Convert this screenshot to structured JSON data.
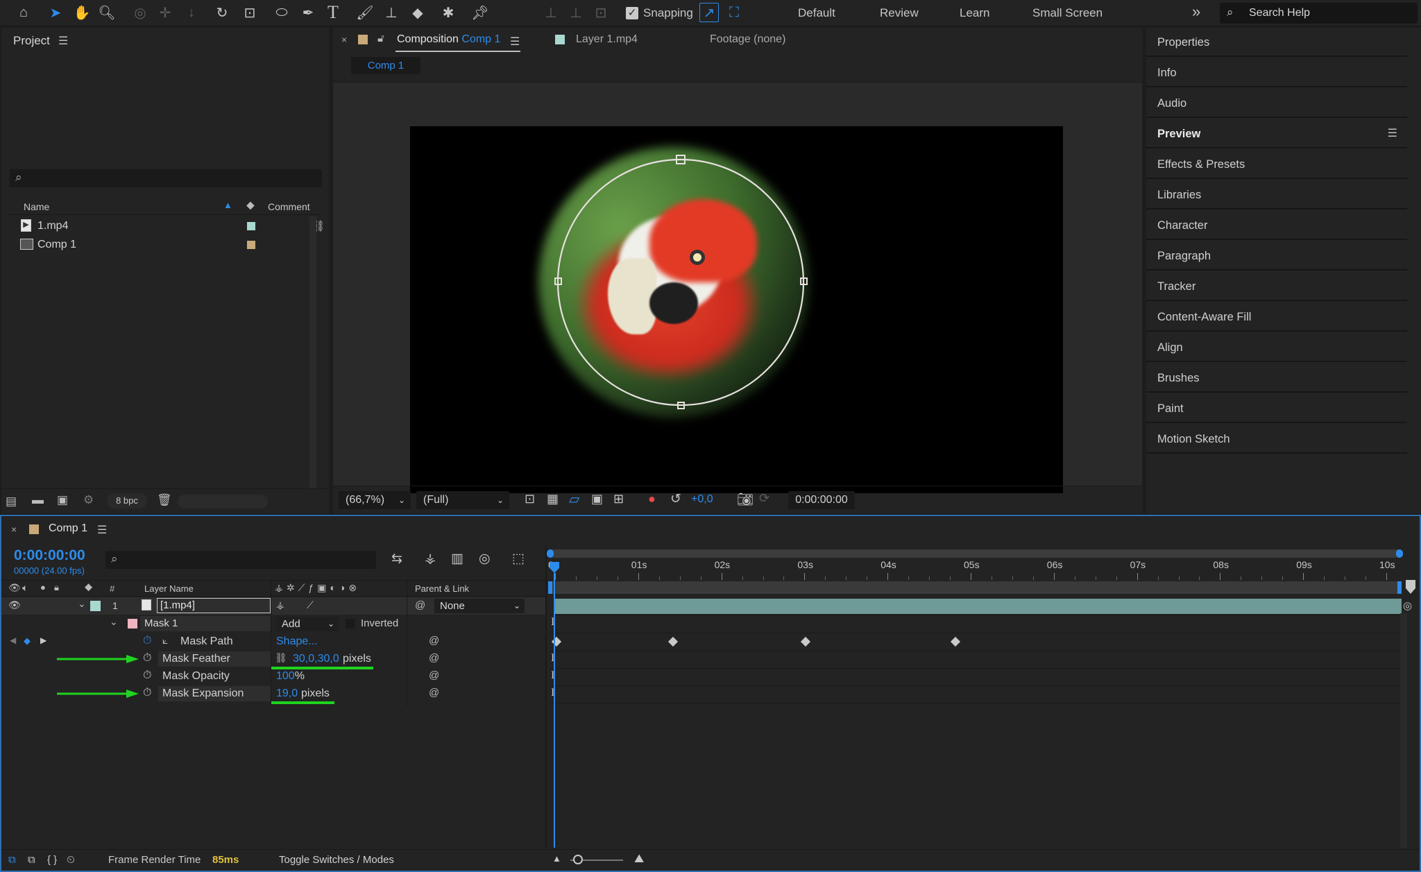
{
  "toolbar": {
    "snapping_label": "Snapping",
    "workspaces": [
      "Default",
      "Review",
      "Learn",
      "Small Screen"
    ],
    "more_label": "»",
    "search_placeholder": "Search Help"
  },
  "project": {
    "title": "Project",
    "col_name": "Name",
    "col_comment": "Comment",
    "items": [
      {
        "name": "1.mp4",
        "label_color": "#a8d8d0"
      },
      {
        "name": "Comp 1",
        "label_color": "#c9a97a"
      }
    ],
    "bpc": "8 bpc"
  },
  "viewer": {
    "tab_composition": "Composition",
    "tab_composition_name": "Comp 1",
    "tab_layer": "Layer 1.mp4",
    "tab_footage": "Footage (none)",
    "subtab": "Comp 1",
    "zoom": "(66,7%)",
    "resolution": "(Full)",
    "exposure": "+0,0",
    "timecode": "0:00:00:00"
  },
  "side_panels": [
    "Properties",
    "Info",
    "Audio",
    "Preview",
    "Effects & Presets",
    "Libraries",
    "Character",
    "Paragraph",
    "Tracker",
    "Content-Aware Fill",
    "Align",
    "Brushes",
    "Paint",
    "Motion Sketch"
  ],
  "timeline": {
    "comp_name": "Comp 1",
    "current_time": "0:00:00:00",
    "frame_info": "00000 (24.00 fps)",
    "col_num": "#",
    "col_layer_name": "Layer Name",
    "col_parent": "Parent & Link",
    "layer": {
      "num": "1",
      "name": "[1.mp4]",
      "parent": "None"
    },
    "mask": {
      "name": "Mask 1",
      "mode": "Add",
      "inverted_label": "Inverted",
      "path_label": "Mask Path",
      "path_value": "Shape...",
      "feather_label": "Mask Feather",
      "feather_value": "30,0,30,0",
      "feather_unit": "pixels",
      "opacity_label": "Mask Opacity",
      "opacity_value": "100",
      "opacity_unit": "%",
      "expansion_label": "Mask Expansion",
      "expansion_value": "19,0",
      "expansion_unit": "pixels"
    },
    "ruler": [
      "0s",
      "01s",
      "02s",
      "03s",
      "04s",
      "05s",
      "06s",
      "07s",
      "08s",
      "09s",
      "10s"
    ],
    "keyframes_seconds": [
      0,
      1.4,
      3.0,
      4.8
    ],
    "footer_render_label": "Frame Render Time",
    "footer_render_value": "85ms",
    "footer_toggle": "Toggle Switches / Modes"
  }
}
